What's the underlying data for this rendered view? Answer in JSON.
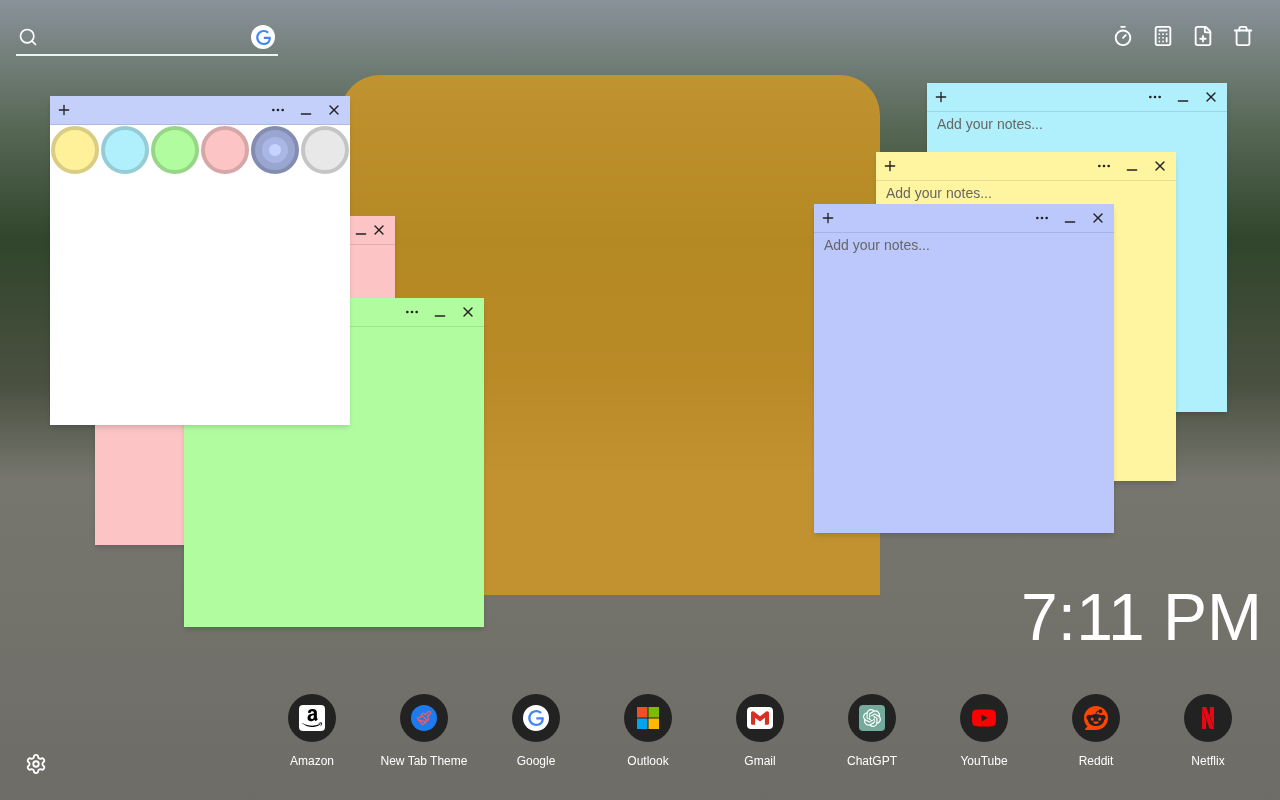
{
  "notes": [
    {
      "kind": "note",
      "color": "#b0f0fc",
      "placeholder": "Add your notes..."
    },
    {
      "kind": "note",
      "color": "#fff5a0",
      "placeholder": "Add your notes..."
    },
    {
      "kind": "note",
      "color": "#bcc8fc",
      "placeholder": "Add your notes..."
    },
    {
      "kind": "note",
      "color": "#fcc4c4"
    },
    {
      "kind": "note",
      "color": "#b2fca0"
    },
    {
      "kind": "palette",
      "color": "#c4d0fa",
      "swatches": [
        {
          "color": "#fff09a",
          "selected": false
        },
        {
          "color": "#b0f0fc",
          "selected": false
        },
        {
          "color": "#b2fca0",
          "selected": false
        },
        {
          "color": "#fcc4c4",
          "selected": false
        },
        {
          "color": "#9aa6d0",
          "selected": true
        },
        {
          "color": "#e8e8e8",
          "selected": false
        }
      ]
    }
  ],
  "clock": "7:11 PM",
  "shortcuts": [
    {
      "label": "Amazon"
    },
    {
      "label": "New Tab Theme"
    },
    {
      "label": "Google"
    },
    {
      "label": "Outlook"
    },
    {
      "label": "Gmail"
    },
    {
      "label": "ChatGPT"
    },
    {
      "label": "YouTube"
    },
    {
      "label": "Reddit"
    },
    {
      "label": "Netflix"
    }
  ]
}
